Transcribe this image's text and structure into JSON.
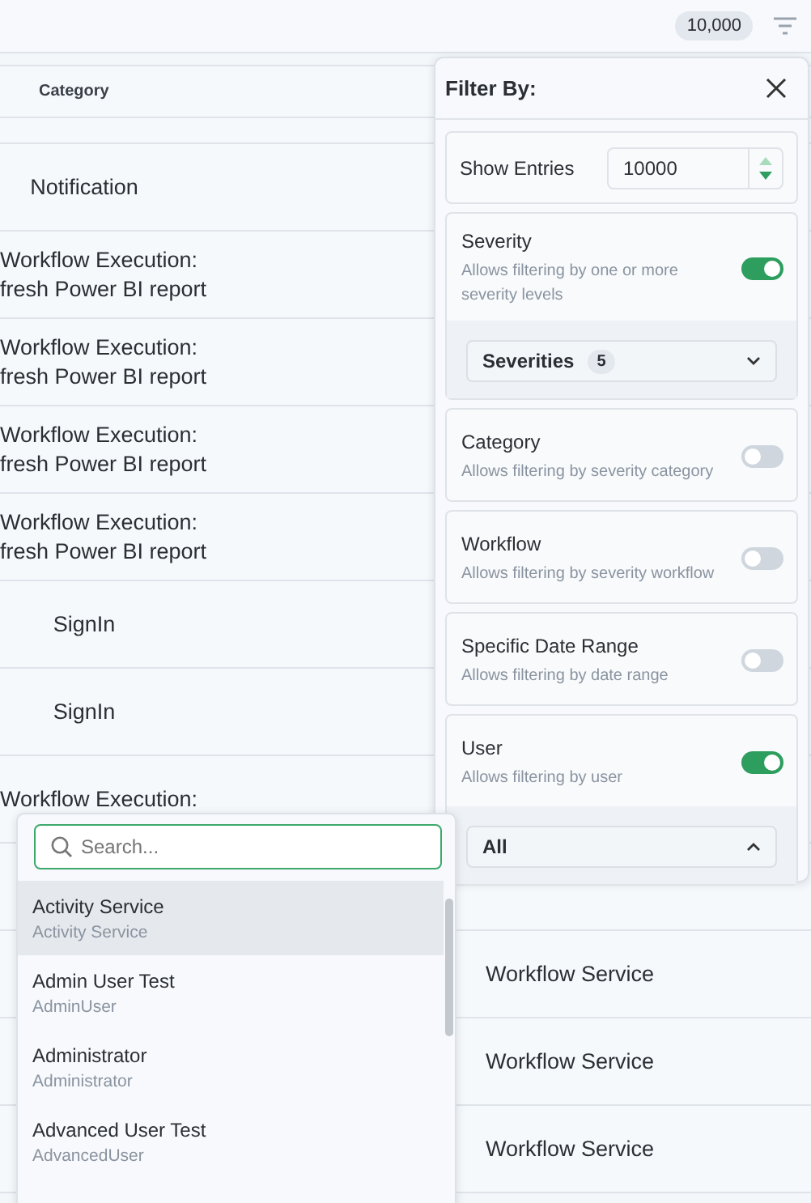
{
  "topbar": {
    "count": "10,000"
  },
  "table": {
    "columns": [
      "Category"
    ],
    "rows": [
      {
        "category": [],
        "service": ""
      },
      {
        "category": [
          "Notification"
        ],
        "kind": "centered",
        "service": ""
      },
      {
        "category": [
          "Workflow Execution:",
          "fresh Power BI report"
        ],
        "kind": "wrapped",
        "service": ""
      },
      {
        "category": [
          "Workflow Execution:",
          "fresh Power BI report"
        ],
        "kind": "wrapped",
        "service": ""
      },
      {
        "category": [
          "Workflow Execution:",
          "fresh Power BI report"
        ],
        "kind": "wrapped",
        "service": ""
      },
      {
        "category": [
          "Workflow Execution:",
          "fresh Power BI report"
        ],
        "kind": "wrapped",
        "service": ""
      },
      {
        "category": [
          "SignIn"
        ],
        "kind": "centered",
        "service": ""
      },
      {
        "category": [
          "SignIn"
        ],
        "kind": "centered",
        "service": ""
      },
      {
        "category": [
          "Workflow Execution:"
        ],
        "kind": "wrapped",
        "service": ""
      },
      {
        "category": [],
        "service": ""
      },
      {
        "category": [],
        "service": "Workflow Service"
      },
      {
        "category": [],
        "service": "Workflow Service"
      },
      {
        "category": [],
        "service": "Workflow Service"
      }
    ]
  },
  "filter_panel": {
    "title": "Filter By:",
    "show_entries": {
      "label": "Show Entries",
      "value": "10000"
    },
    "sections": [
      {
        "title": "Severity",
        "description": "Allows filtering by one or more severity levels",
        "on": true,
        "select": {
          "label": "Severities",
          "count": "5",
          "expanded": false
        }
      },
      {
        "title": "Category",
        "description": "Allows filtering by severity category",
        "on": false
      },
      {
        "title": "Workflow",
        "description": "Allows filtering by severity workflow",
        "on": false
      },
      {
        "title": "Specific Date Range",
        "description": "Allows filtering by date range",
        "on": false
      },
      {
        "title": "User",
        "description": "Allows filtering by user",
        "on": true,
        "select": {
          "label": "All",
          "expanded": true
        }
      }
    ]
  },
  "user_dropdown": {
    "search": {
      "placeholder": "Search..."
    },
    "options": [
      {
        "name": "Activity Service",
        "username": "Activity Service",
        "selected": true
      },
      {
        "name": "Admin User Test",
        "username": "AdminUser",
        "selected": false
      },
      {
        "name": "Administrator",
        "username": "Administrator",
        "selected": false
      },
      {
        "name": "Advanced User Test",
        "username": "AdvancedUser",
        "selected": false
      }
    ]
  }
}
